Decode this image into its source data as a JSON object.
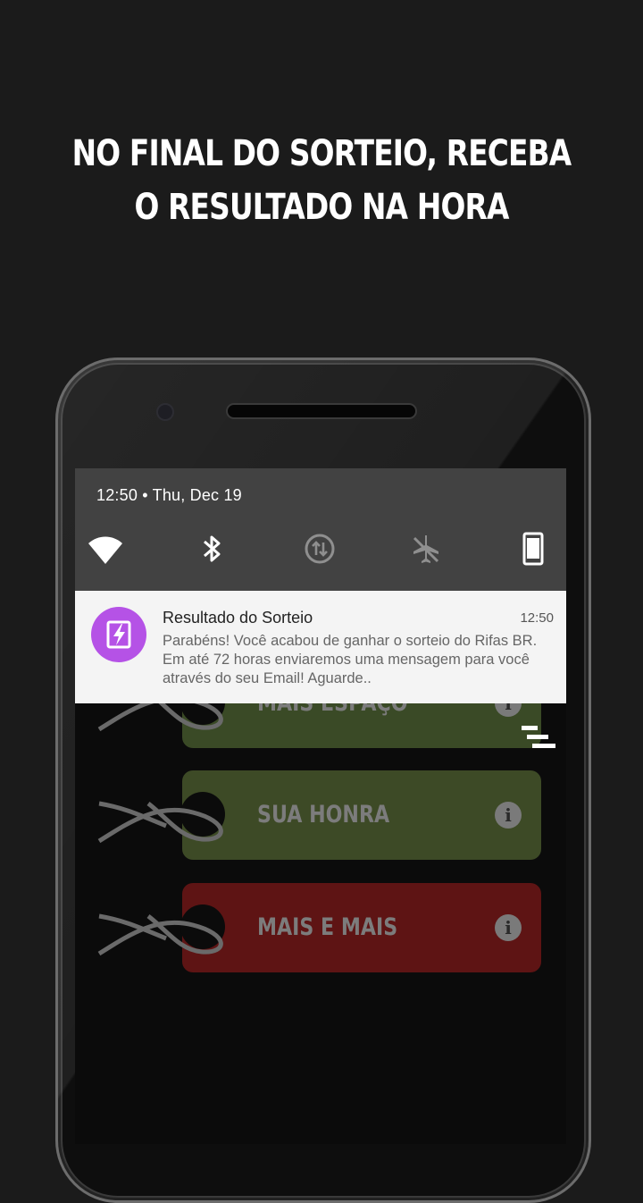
{
  "headline": {
    "line1": "NO FINAL DO SORTEIO, RECEBA",
    "line2": "O RESULTADO NA HORA"
  },
  "status": {
    "time_date": "12:50 • Thu, Dec 19"
  },
  "quick_settings": [
    {
      "name": "wifi-icon"
    },
    {
      "name": "bluetooth-icon"
    },
    {
      "name": "data-sync-icon"
    },
    {
      "name": "airplane-mode-icon"
    },
    {
      "name": "phone-rotate-icon"
    }
  ],
  "notification": {
    "title": "Resultado do Sorteio",
    "time": "12:50",
    "body": "Parabéns! Você acabou de ganhar o sorteio do Rifas BR. Em até 72 horas enviaremos uma mensagem para você através do seu Email! Aguarde..",
    "icon": "lightning-icon",
    "icon_color": "#b552e6"
  },
  "tags": [
    {
      "label": "MAIS ESPAÇO",
      "color": "#3a4a26"
    },
    {
      "label": "SUA HONRA",
      "color": "#3d4a26"
    },
    {
      "label": "MAIS E MAIS",
      "color": "#5e1414"
    }
  ],
  "colors": {
    "background": "#1b1b1b",
    "shade": "#424242",
    "notification_bg": "#f4f4f4"
  }
}
